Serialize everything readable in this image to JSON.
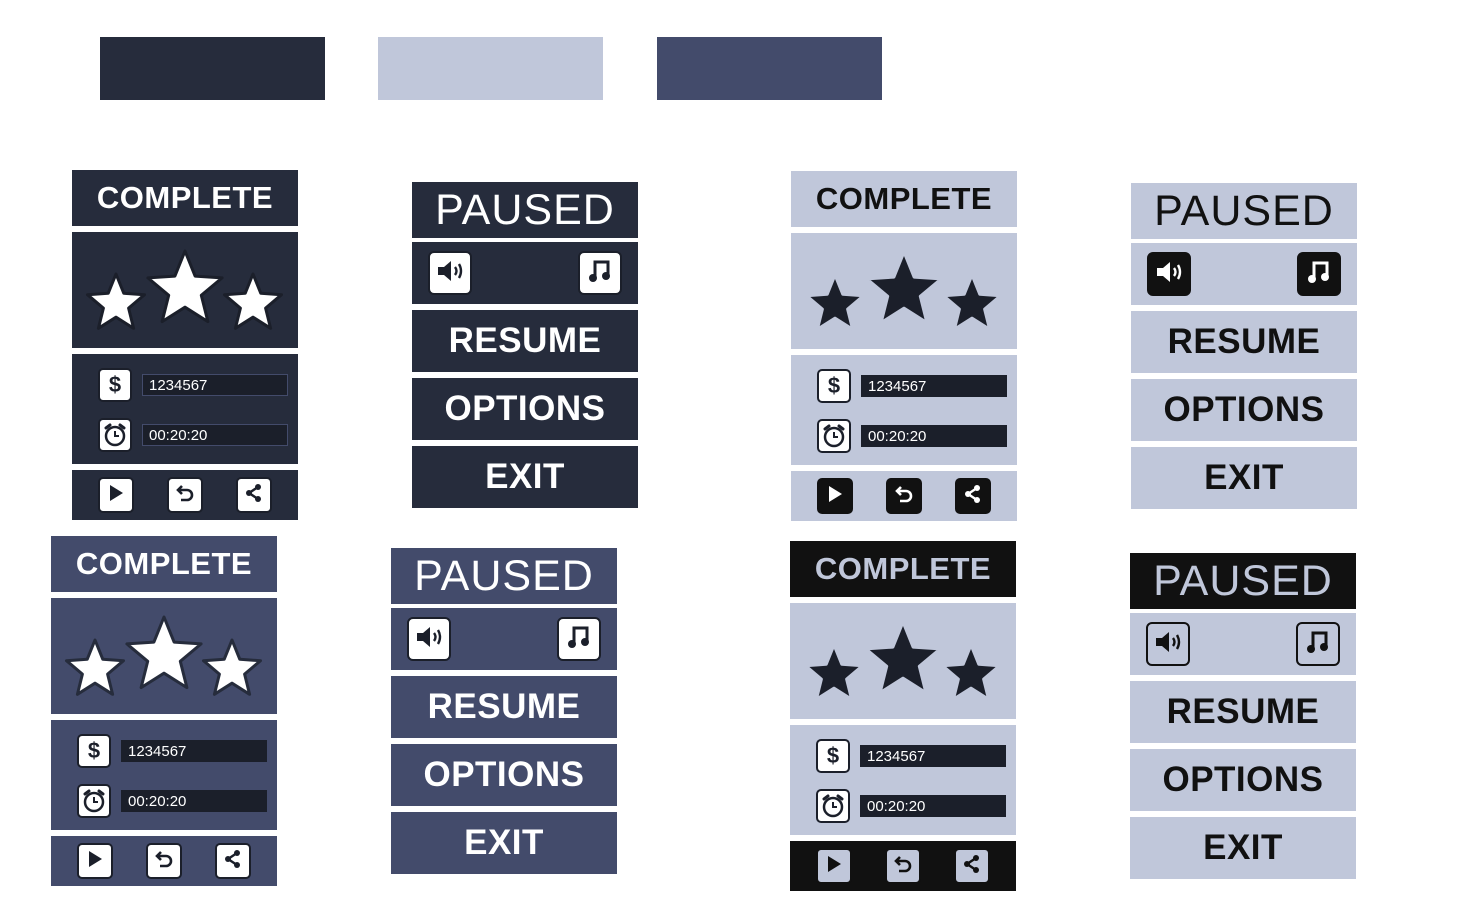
{
  "palette": {
    "dark": "#262c3c",
    "light": "#c0c7da",
    "mid": "#434b6b",
    "black": "#111111"
  },
  "complete": {
    "title": "COMPLETE",
    "money": "1234567",
    "time": "00:20:20",
    "money_icon": "dollar-icon",
    "time_icon": "alarm-clock-icon",
    "stars": 3
  },
  "paused": {
    "title": "PAUSED",
    "sound_icon": "speaker-icon",
    "music_icon": "music-note-icon",
    "resume": "RESUME",
    "options": "OPTIONS",
    "exit": "EXIT"
  },
  "actions": {
    "play_icon": "play-icon",
    "restart_icon": "restart-icon",
    "share_icon": "share-icon"
  }
}
